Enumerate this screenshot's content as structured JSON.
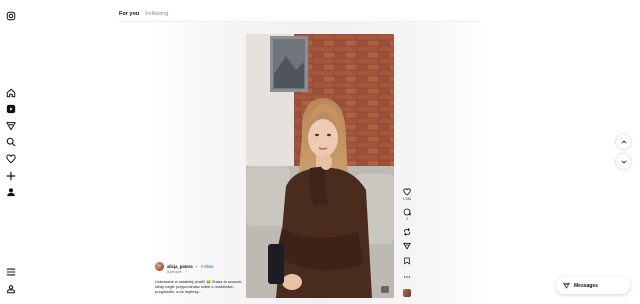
{
  "sidebar": {
    "top_icon": "instagram-logo-icon",
    "items": [
      {
        "icon": "home-icon"
      },
      {
        "icon": "reels-icon"
      },
      {
        "icon": "explore-icon"
      },
      {
        "icon": "search-icon"
      },
      {
        "icon": "heart-icon"
      },
      {
        "icon": "create-icon"
      },
      {
        "icon": "profile-icon"
      }
    ],
    "bottom_items": [
      {
        "icon": "menu-icon"
      },
      {
        "icon": "threads-icon"
      }
    ]
  },
  "tabs": [
    {
      "label": "For you",
      "active": true
    },
    {
      "label": "Following",
      "active": false
    }
  ],
  "post": {
    "username": "alicja_patora",
    "separator": "•",
    "follow_label": "Follow",
    "sub_label": "8 people",
    "caption": "Uratowane w ostatniej chwili! 😅 Znasz to uczucie, kiedy nagle przypominasz sobie o urodzinach przyjaciółki, a do imprezy..."
  },
  "actions": {
    "like_count": "1,546",
    "comment_count": "3"
  },
  "messages": {
    "label": "Messages"
  },
  "colors": {
    "accent": "#2a66d9",
    "text": "#111111",
    "muted": "#8a8a8a"
  }
}
